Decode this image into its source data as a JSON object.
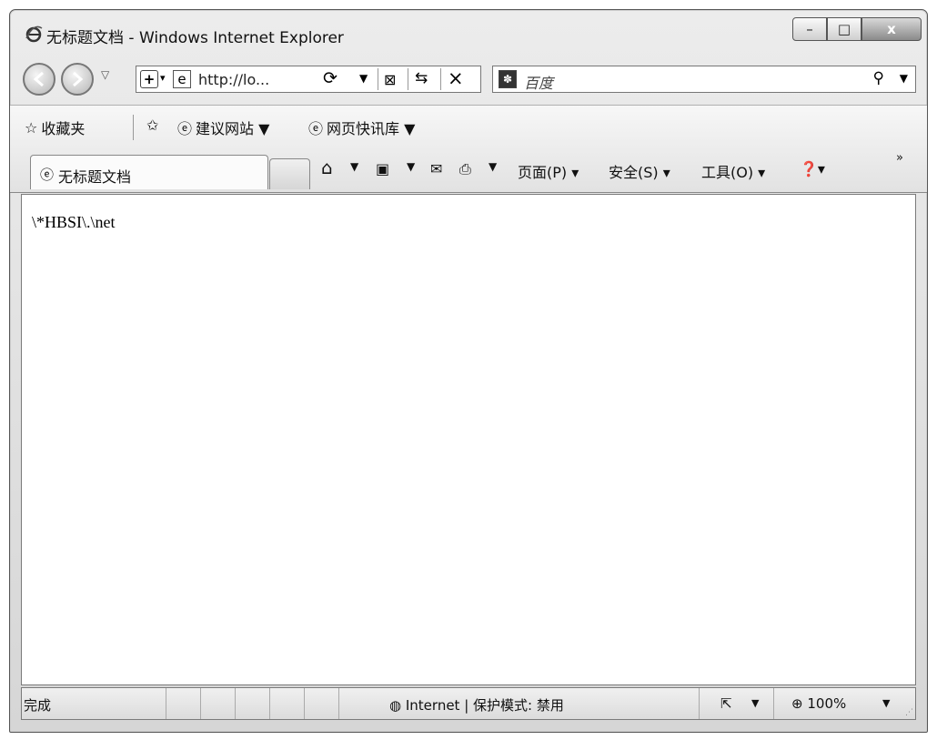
{
  "window": {
    "title": "无标题文档 - Windows Internet Explorer",
    "controls": {
      "minimize": "–",
      "maximize": "□",
      "close": "x"
    }
  },
  "nav": {
    "address": {
      "url": "http://lo..."
    },
    "search": {
      "provider_icon": "paw-icon",
      "placeholder": "百度"
    }
  },
  "favorites_bar": {
    "favorites_label": "收藏夹",
    "items": [
      {
        "label": "建议网站 ▼"
      },
      {
        "label": "网页快讯库 ▼"
      }
    ]
  },
  "tabs": [
    {
      "label": "无标题文档",
      "active": true
    }
  ],
  "command_bar": {
    "page": "页面(P) ▾",
    "safety": "安全(S) ▾",
    "tools": "工具(O) ▾",
    "more": "»"
  },
  "content": {
    "text": "\\*HBSI\\.\\net"
  },
  "status_bar": {
    "status": "完成",
    "zone": "Internet | 保护模式: 禁用",
    "zoom": "100%"
  }
}
